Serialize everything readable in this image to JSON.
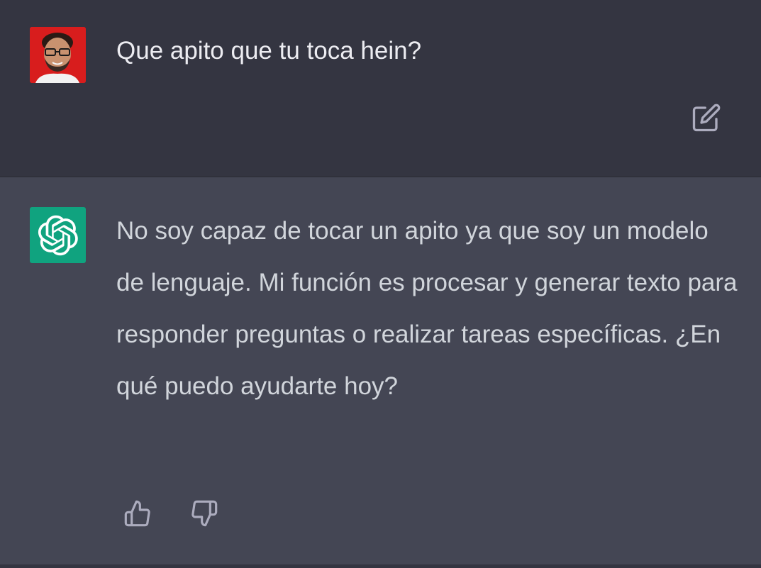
{
  "conversation": {
    "user_message": {
      "avatar": "user-photo-avatar",
      "text": "Que apito que tu toca hein?",
      "edit_icon": "edit-icon"
    },
    "assistant_message": {
      "avatar": "openai-logo-icon",
      "text": "No soy capaz de tocar un apito ya que soy un modelo de lenguaje. Mi función es procesar y generar texto para responder preguntas o realizar tareas específicas. ¿En qué puedo ayudarte hoy?",
      "feedback": {
        "thumbs_up_icon": "thumbs-up-icon",
        "thumbs_down_icon": "thumbs-down-icon"
      }
    }
  },
  "colors": {
    "user_bg": "#343541",
    "assistant_bg": "#444654",
    "openai_green": "#10a37f",
    "user_avatar_bg": "#d81d1d",
    "text_primary": "#ececf1",
    "text_secondary": "#d1d5db",
    "icon_color": "#acacbe"
  }
}
